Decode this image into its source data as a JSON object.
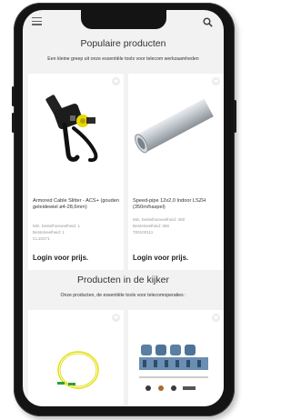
{
  "header": {
    "menu_icon": "hamburger-icon",
    "search_icon": "search-icon"
  },
  "popular": {
    "title": "Populaire producten",
    "subtitle": "Een kleine greep uit onze essentiële tools voor telecom werkzaamheden",
    "products": [
      {
        "name": "Armored Cable Slitter - ACS+ (gouden geleidewiel ø4-28,6mm)",
        "meta1": "Min. bestelhoeveelheid: 1",
        "meta2": "Bestelveelheid: 1",
        "meta3": "CL10271",
        "login": "Login voor prijs."
      },
      {
        "name": "Speed-pipe 12x2,0 Indoor LSZH (350m/haspel)",
        "meta1": "Min. bestelhoeveelheid: 350",
        "meta2": "Bestelveelheid: 350",
        "meta3": "700100111",
        "login": "Login voor prijs."
      }
    ]
  },
  "featured": {
    "title": "Producten in de kijker",
    "subtitle": "Onze producten, de essentiële tools voor telecomoperaties :"
  },
  "colors": {
    "bezel": "#141414",
    "screen_bg": "#f2f2f2",
    "card_bg": "#ffffff",
    "accent_yellow": "#e8d800"
  }
}
